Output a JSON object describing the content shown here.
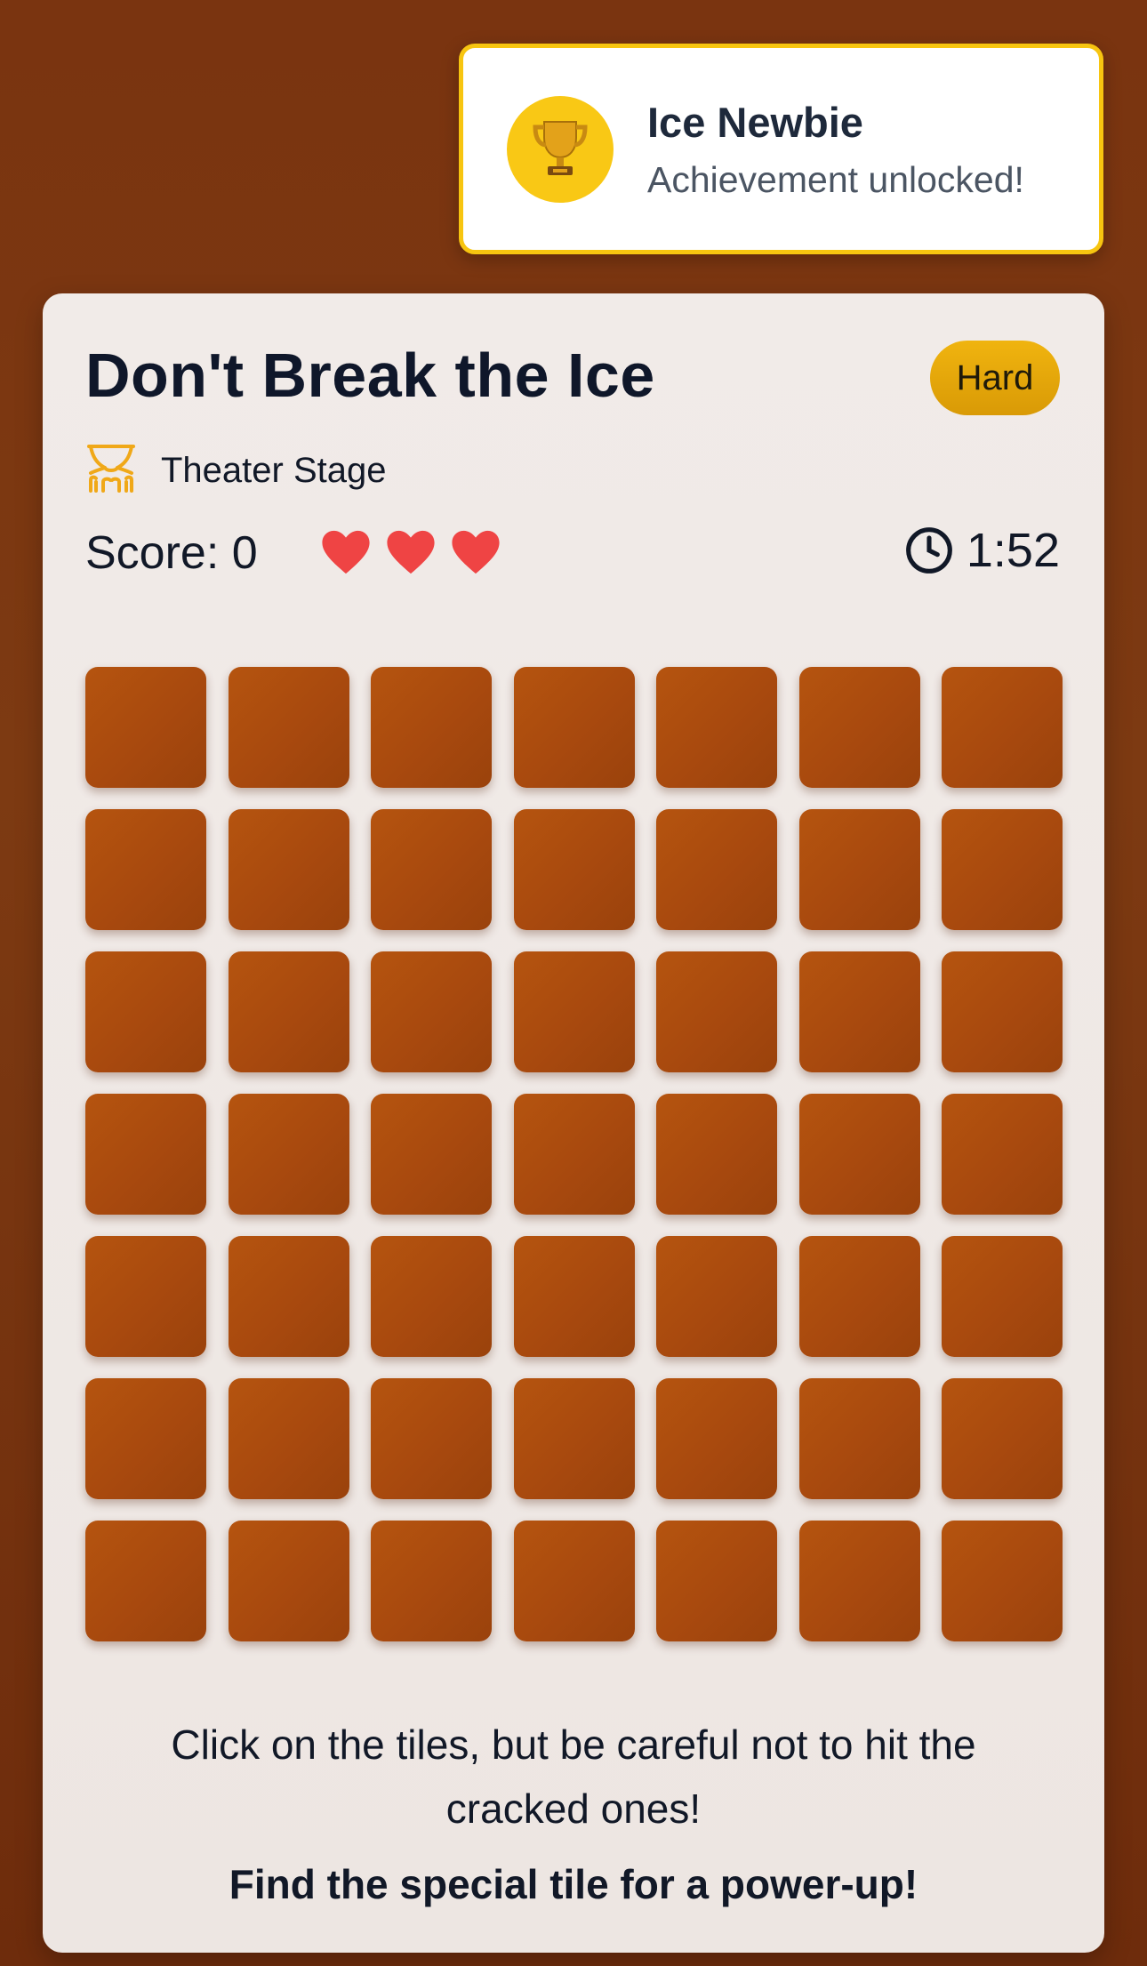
{
  "toast": {
    "title": "Ice Newbie",
    "subtitle": "Achievement unlocked!",
    "icon": "trophy-icon",
    "border_color": "#f7c510"
  },
  "game": {
    "title": "Don't Break the Ice",
    "difficulty": "Hard",
    "location": {
      "label": "Theater Stage",
      "icon": "theater-curtain-icon"
    },
    "score_text": "Score: 0",
    "lives": 3,
    "timer": "1:52",
    "grid": {
      "rows": 7,
      "cols": 7
    },
    "instructions": "Click on the tiles, but be careful not to hit the cracked ones!",
    "tip": "Find the special tile for a power-up!"
  },
  "colors": {
    "background": "#7a3410",
    "tile": "#b0500e",
    "heart": "#ef4444",
    "badge": "#e8aa0b",
    "trophy_circle": "#f9c815"
  }
}
